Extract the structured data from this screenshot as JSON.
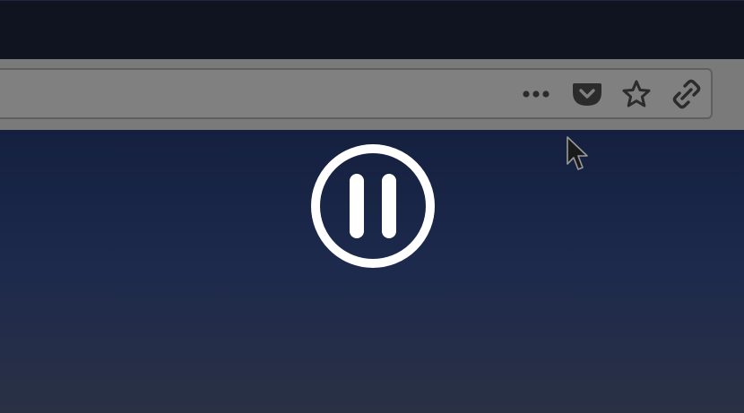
{
  "screen": {
    "description_colors": {
      "title_strip": "#101320",
      "toolbar": "#7a7a7a",
      "icon": "#2b2b2b",
      "overlay_icon": "#ffffff"
    }
  },
  "toolbar": {
    "icons": [
      {
        "name": "more-options-icon"
      },
      {
        "name": "pocket-icon"
      },
      {
        "name": "bookmark-star-icon"
      },
      {
        "name": "link-icon"
      }
    ]
  },
  "overlay": {
    "icon": "pause-icon"
  }
}
